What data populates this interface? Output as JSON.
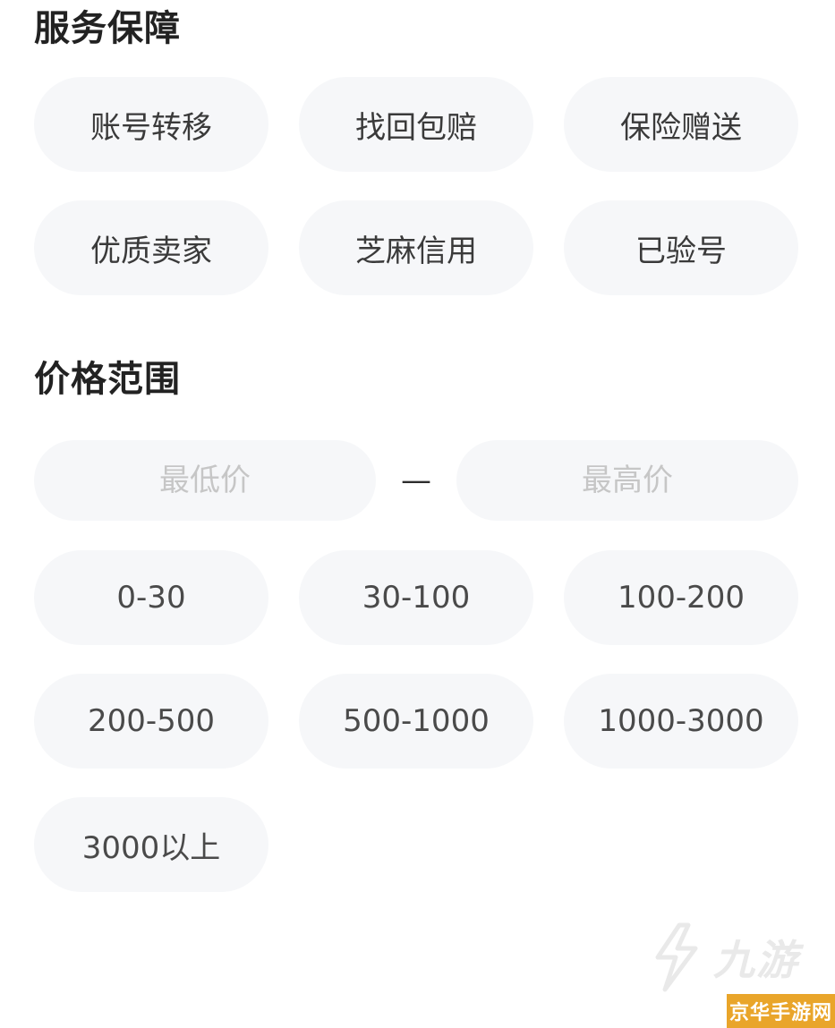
{
  "service": {
    "title": "服务保障",
    "options": [
      {
        "label": "账号转移"
      },
      {
        "label": "找回包赔"
      },
      {
        "label": "保险赠送"
      },
      {
        "label": "优质卖家"
      },
      {
        "label": "芝麻信用"
      },
      {
        "label": "已验号"
      }
    ]
  },
  "price": {
    "title": "价格范围",
    "min_placeholder": "最低价",
    "separator": "—",
    "max_placeholder": "最高价",
    "options": [
      {
        "label": "0-30"
      },
      {
        "label": "30-100"
      },
      {
        "label": "100-200"
      },
      {
        "label": "200-500"
      },
      {
        "label": "500-1000"
      },
      {
        "label": "1000-3000"
      },
      {
        "label": "3000以上"
      }
    ]
  },
  "watermark": {
    "text": "九游",
    "icon": "jiuyou-logo-icon"
  },
  "site_badge": {
    "text": "京华手游网",
    "color": "#e9a52a"
  }
}
